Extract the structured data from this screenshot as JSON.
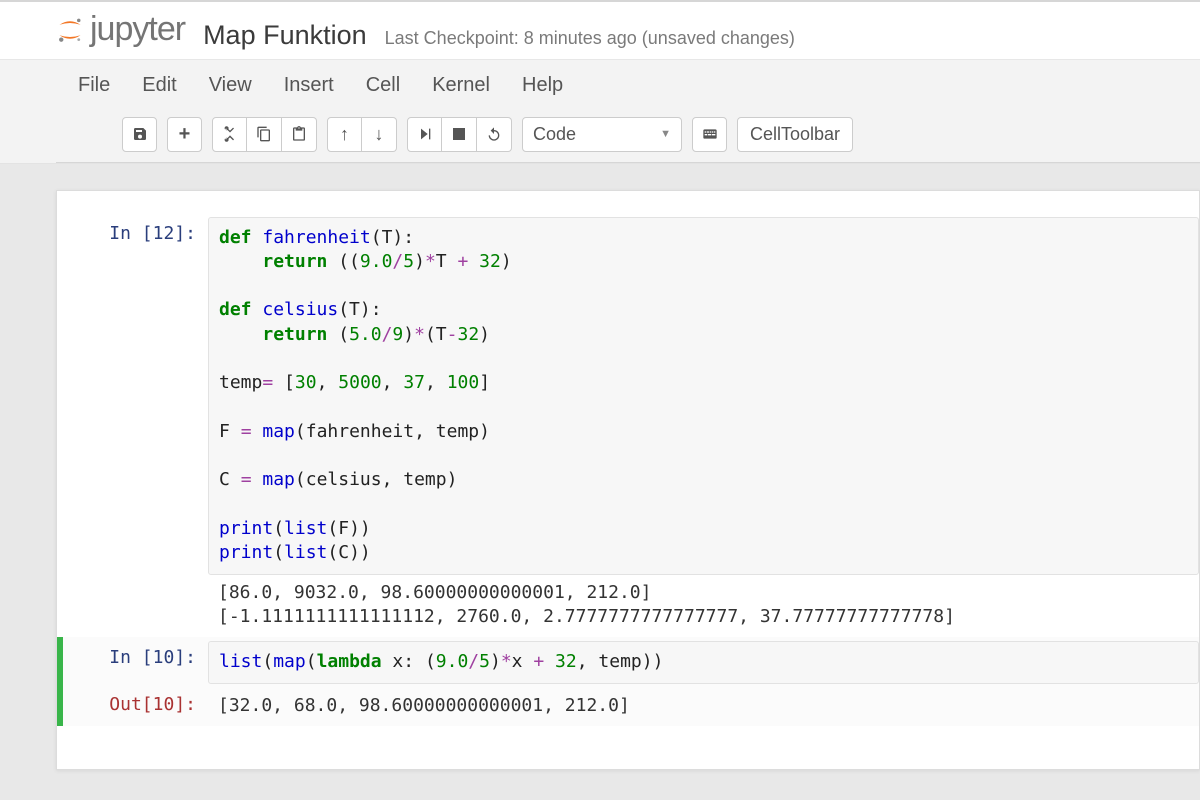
{
  "header": {
    "brand": "jupyter",
    "title": "Map Funktion",
    "checkpoint": "Last Checkpoint: 8 minutes ago (unsaved changes)"
  },
  "menubar": [
    "File",
    "Edit",
    "View",
    "Insert",
    "Cell",
    "Kernel",
    "Help"
  ],
  "toolbar": {
    "celltype_selected": "Code",
    "cell_toolbar_label": "CellToolbar"
  },
  "cells": [
    {
      "type": "code",
      "exec_count": 12,
      "in_prompt": "In [12]:",
      "source_tokens": [
        [
          [
            "kw",
            "def "
          ],
          [
            "fn",
            "fahrenheit"
          ],
          [
            "brk",
            "(T):"
          ]
        ],
        [
          [
            "txt",
            "    "
          ],
          [
            "kw",
            "return "
          ],
          [
            "brk",
            "(("
          ],
          [
            "num",
            "9.0"
          ],
          [
            "op",
            "/"
          ],
          [
            "num",
            "5"
          ],
          [
            "brk",
            ")"
          ],
          [
            "op",
            "*"
          ],
          [
            "txt",
            "T "
          ],
          [
            "op",
            "+"
          ],
          [
            "txt",
            " "
          ],
          [
            "num",
            "32"
          ],
          [
            "brk",
            ")"
          ]
        ],
        [],
        [
          [
            "kw",
            "def "
          ],
          [
            "fn",
            "celsius"
          ],
          [
            "brk",
            "(T):"
          ]
        ],
        [
          [
            "txt",
            "    "
          ],
          [
            "kw",
            "return "
          ],
          [
            "brk",
            "("
          ],
          [
            "num",
            "5.0"
          ],
          [
            "op",
            "/"
          ],
          [
            "num",
            "9"
          ],
          [
            "brk",
            ")"
          ],
          [
            "op",
            "*"
          ],
          [
            "brk",
            "(T"
          ],
          [
            "op",
            "-"
          ],
          [
            "num",
            "32"
          ],
          [
            "brk",
            ")"
          ]
        ],
        [],
        [
          [
            "txt",
            "temp"
          ],
          [
            "op",
            "="
          ],
          [
            "txt",
            " "
          ],
          [
            "brk",
            "["
          ],
          [
            "num",
            "30"
          ],
          [
            "txt",
            ", "
          ],
          [
            "num",
            "5000"
          ],
          [
            "txt",
            ", "
          ],
          [
            "num",
            "37"
          ],
          [
            "txt",
            ", "
          ],
          [
            "num",
            "100"
          ],
          [
            "brk",
            "]"
          ]
        ],
        [],
        [
          [
            "txt",
            "F "
          ],
          [
            "op",
            "="
          ],
          [
            "txt",
            " "
          ],
          [
            "fn",
            "map"
          ],
          [
            "brk",
            "(fahrenheit, temp)"
          ]
        ],
        [],
        [
          [
            "txt",
            "C "
          ],
          [
            "op",
            "="
          ],
          [
            "txt",
            " "
          ],
          [
            "fn",
            "map"
          ],
          [
            "brk",
            "(celsius, temp)"
          ]
        ],
        [],
        [
          [
            "fn",
            "print"
          ],
          [
            "brk",
            "("
          ],
          [
            "fn",
            "list"
          ],
          [
            "brk",
            "(F))"
          ]
        ],
        [
          [
            "fn",
            "print"
          ],
          [
            "brk",
            "("
          ],
          [
            "fn",
            "list"
          ],
          [
            "brk",
            "(C))"
          ]
        ]
      ],
      "stdout": "[86.0, 9032.0, 98.60000000000001, 212.0]\n[-1.1111111111111112, 2760.0, 2.7777777777777777, 37.77777777777778]"
    },
    {
      "type": "code",
      "exec_count": 10,
      "selected": true,
      "in_prompt": "In [10]:",
      "out_prompt": "Out[10]:",
      "source_tokens": [
        [
          [
            "fn",
            "list"
          ],
          [
            "brk",
            "("
          ],
          [
            "fn",
            "map"
          ],
          [
            "brk",
            "("
          ],
          [
            "kw",
            "lambda "
          ],
          [
            "txt",
            "x: "
          ],
          [
            "brk",
            "("
          ],
          [
            "num",
            "9.0"
          ],
          [
            "op",
            "/"
          ],
          [
            "num",
            "5"
          ],
          [
            "brk",
            ")"
          ],
          [
            "op",
            "*"
          ],
          [
            "txt",
            "x "
          ],
          [
            "op",
            "+"
          ],
          [
            "txt",
            " "
          ],
          [
            "num",
            "32"
          ],
          [
            "txt",
            ", temp"
          ],
          [
            "brk",
            "))"
          ]
        ]
      ],
      "result": "[32.0, 68.0, 98.60000000000001, 212.0]"
    }
  ]
}
